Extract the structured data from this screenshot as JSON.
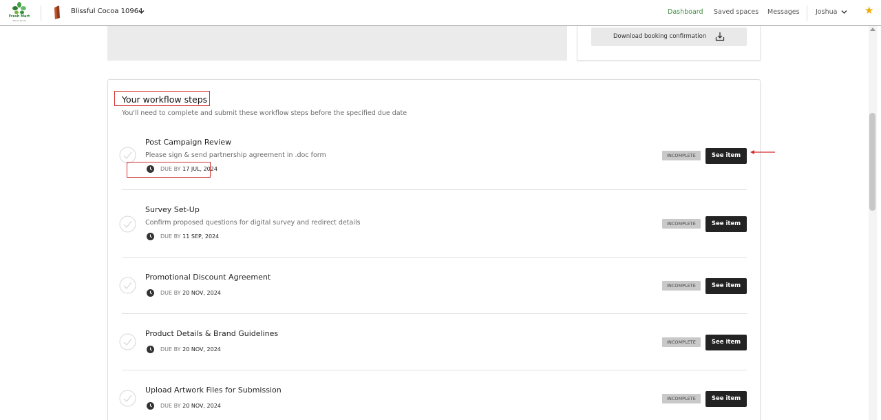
{
  "header": {
    "logo": {
      "name": "Fresh Mart",
      "tagline": "Whole Foods"
    },
    "brand": "Blissful Cocoa 10964",
    "nav": {
      "dashboard": "Dashboard",
      "saved_spaces": "Saved spaces",
      "messages": "Messages"
    },
    "user": "Joshua",
    "accent_color": "#3f8f3f",
    "star_color": "#f2a900"
  },
  "booking": {
    "download_label": "Download booking confirmation"
  },
  "workflow": {
    "title": "Your workflow steps",
    "subtitle": "You'll need to complete and submit these workflow steps before the specified due date",
    "due_prefix": "DUE BY",
    "highlight_color": "#d32f2f",
    "steps": [
      {
        "title": "Post Campaign Review",
        "description": "Please sign & send partnership agreement in .doc form",
        "due": "17 JUL, 2024",
        "status": "INCOMPLETE",
        "action": "See item"
      },
      {
        "title": "Survey Set-Up",
        "description": "Confirm proposed questions for digital survey and redirect details",
        "due": "11 SEP, 2024",
        "status": "INCOMPLETE",
        "action": "See item"
      },
      {
        "title": "Promotional Discount Agreement",
        "description": "",
        "due": "20 NOV, 2024",
        "status": "INCOMPLETE",
        "action": "See item"
      },
      {
        "title": "Product Details & Brand Guidelines",
        "description": "",
        "due": "20 NOV, 2024",
        "status": "INCOMPLETE",
        "action": "See item"
      },
      {
        "title": "Upload Artwork Files for Submission",
        "description": "",
        "due": "20 NOV, 2024",
        "status": "INCOMPLETE",
        "action": "See item"
      }
    ]
  }
}
